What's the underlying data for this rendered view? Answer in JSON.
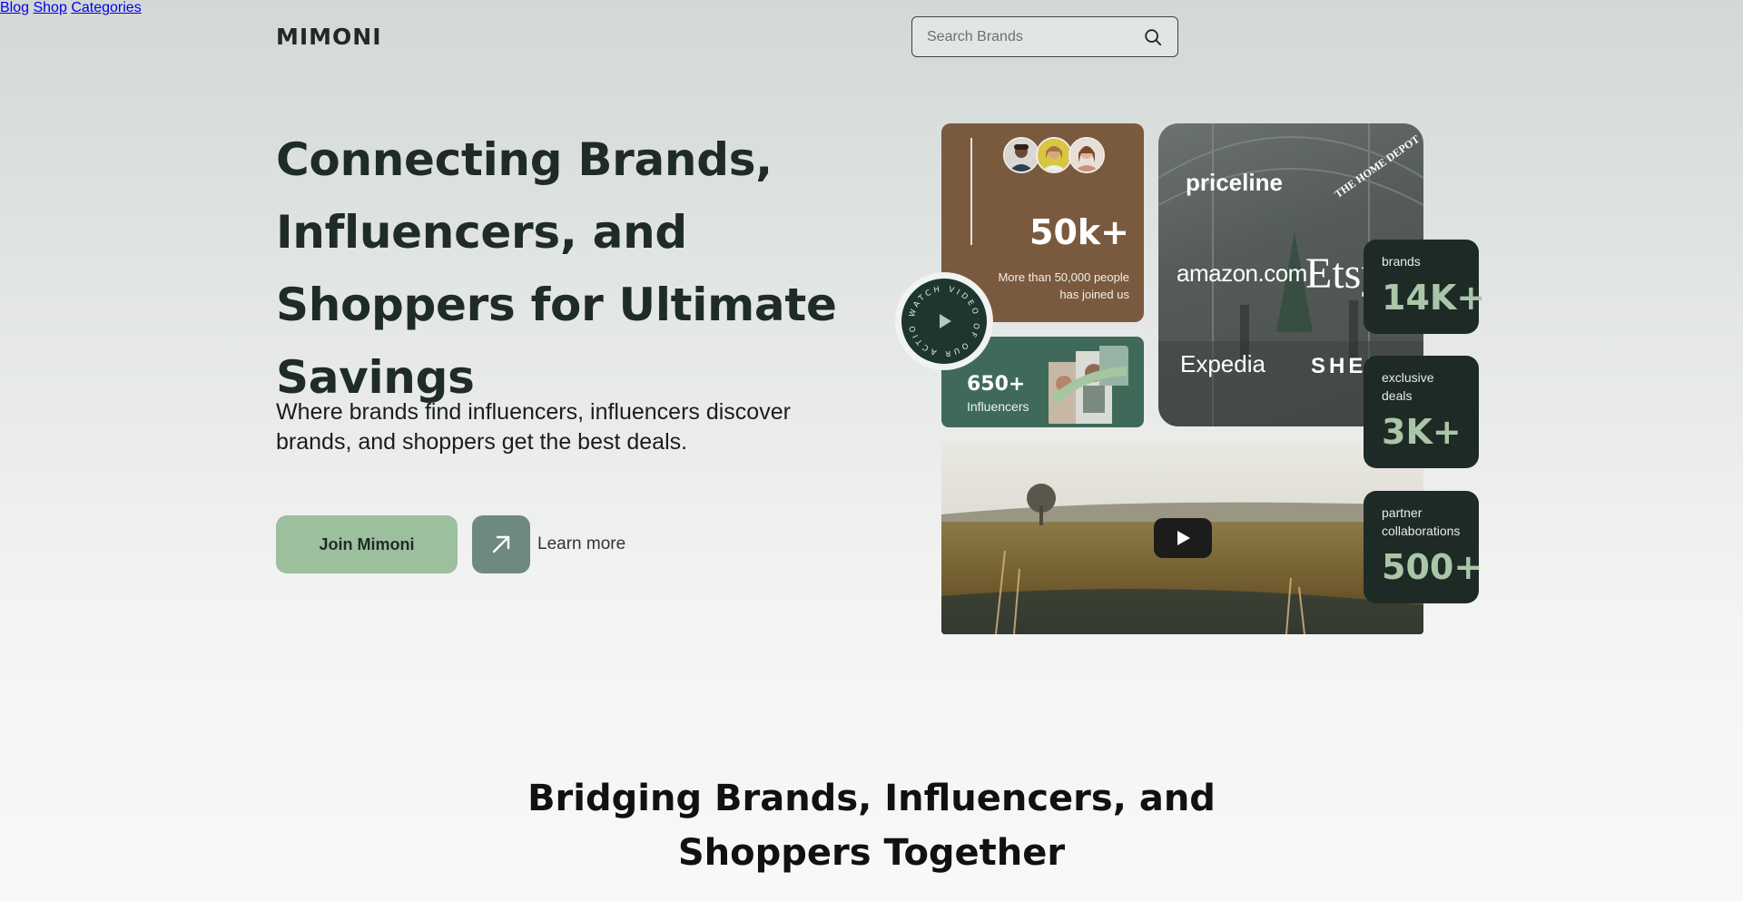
{
  "header": {
    "logo": "MIMONI",
    "search_placeholder": "Search Brands",
    "nav": [
      {
        "label": "Blog"
      },
      {
        "label": "Shop"
      },
      {
        "label": "Categories"
      }
    ]
  },
  "hero": {
    "title": "Connecting Brands, Influencers, and Shoppers for Ultimate Savings",
    "subtitle": "Where brands find influencers, influencers discover brands, and shoppers get the best deals.",
    "join_label": "Join Mimoni",
    "learn_label": "Learn more"
  },
  "members_card": {
    "stat": "50k+",
    "description": "More than 50,000 people has joined us"
  },
  "influencers_card": {
    "stat": "650+",
    "label": "Influencers"
  },
  "watch_badge": {
    "ring_text": "WATCH VIDEO OF OUR ACTION"
  },
  "brand_logos": [
    "priceline",
    "THE HOME DEPOT",
    "amazon.com",
    "Etsy",
    "Expedia",
    "SHEIN"
  ],
  "stats": [
    {
      "title": "brands",
      "value": "14K+"
    },
    {
      "title": "exclusive deals",
      "value": "3K+"
    },
    {
      "title": "partner collaborations",
      "value": "500+"
    }
  ],
  "section": {
    "heading": "Bridging Brands, Influencers, and Shoppers Together"
  },
  "colors": {
    "accent_green": "#9cbf9d",
    "dark_green": "#1e2a26",
    "brown": "#7a5a3e",
    "mid_green": "#3f6a5a"
  }
}
